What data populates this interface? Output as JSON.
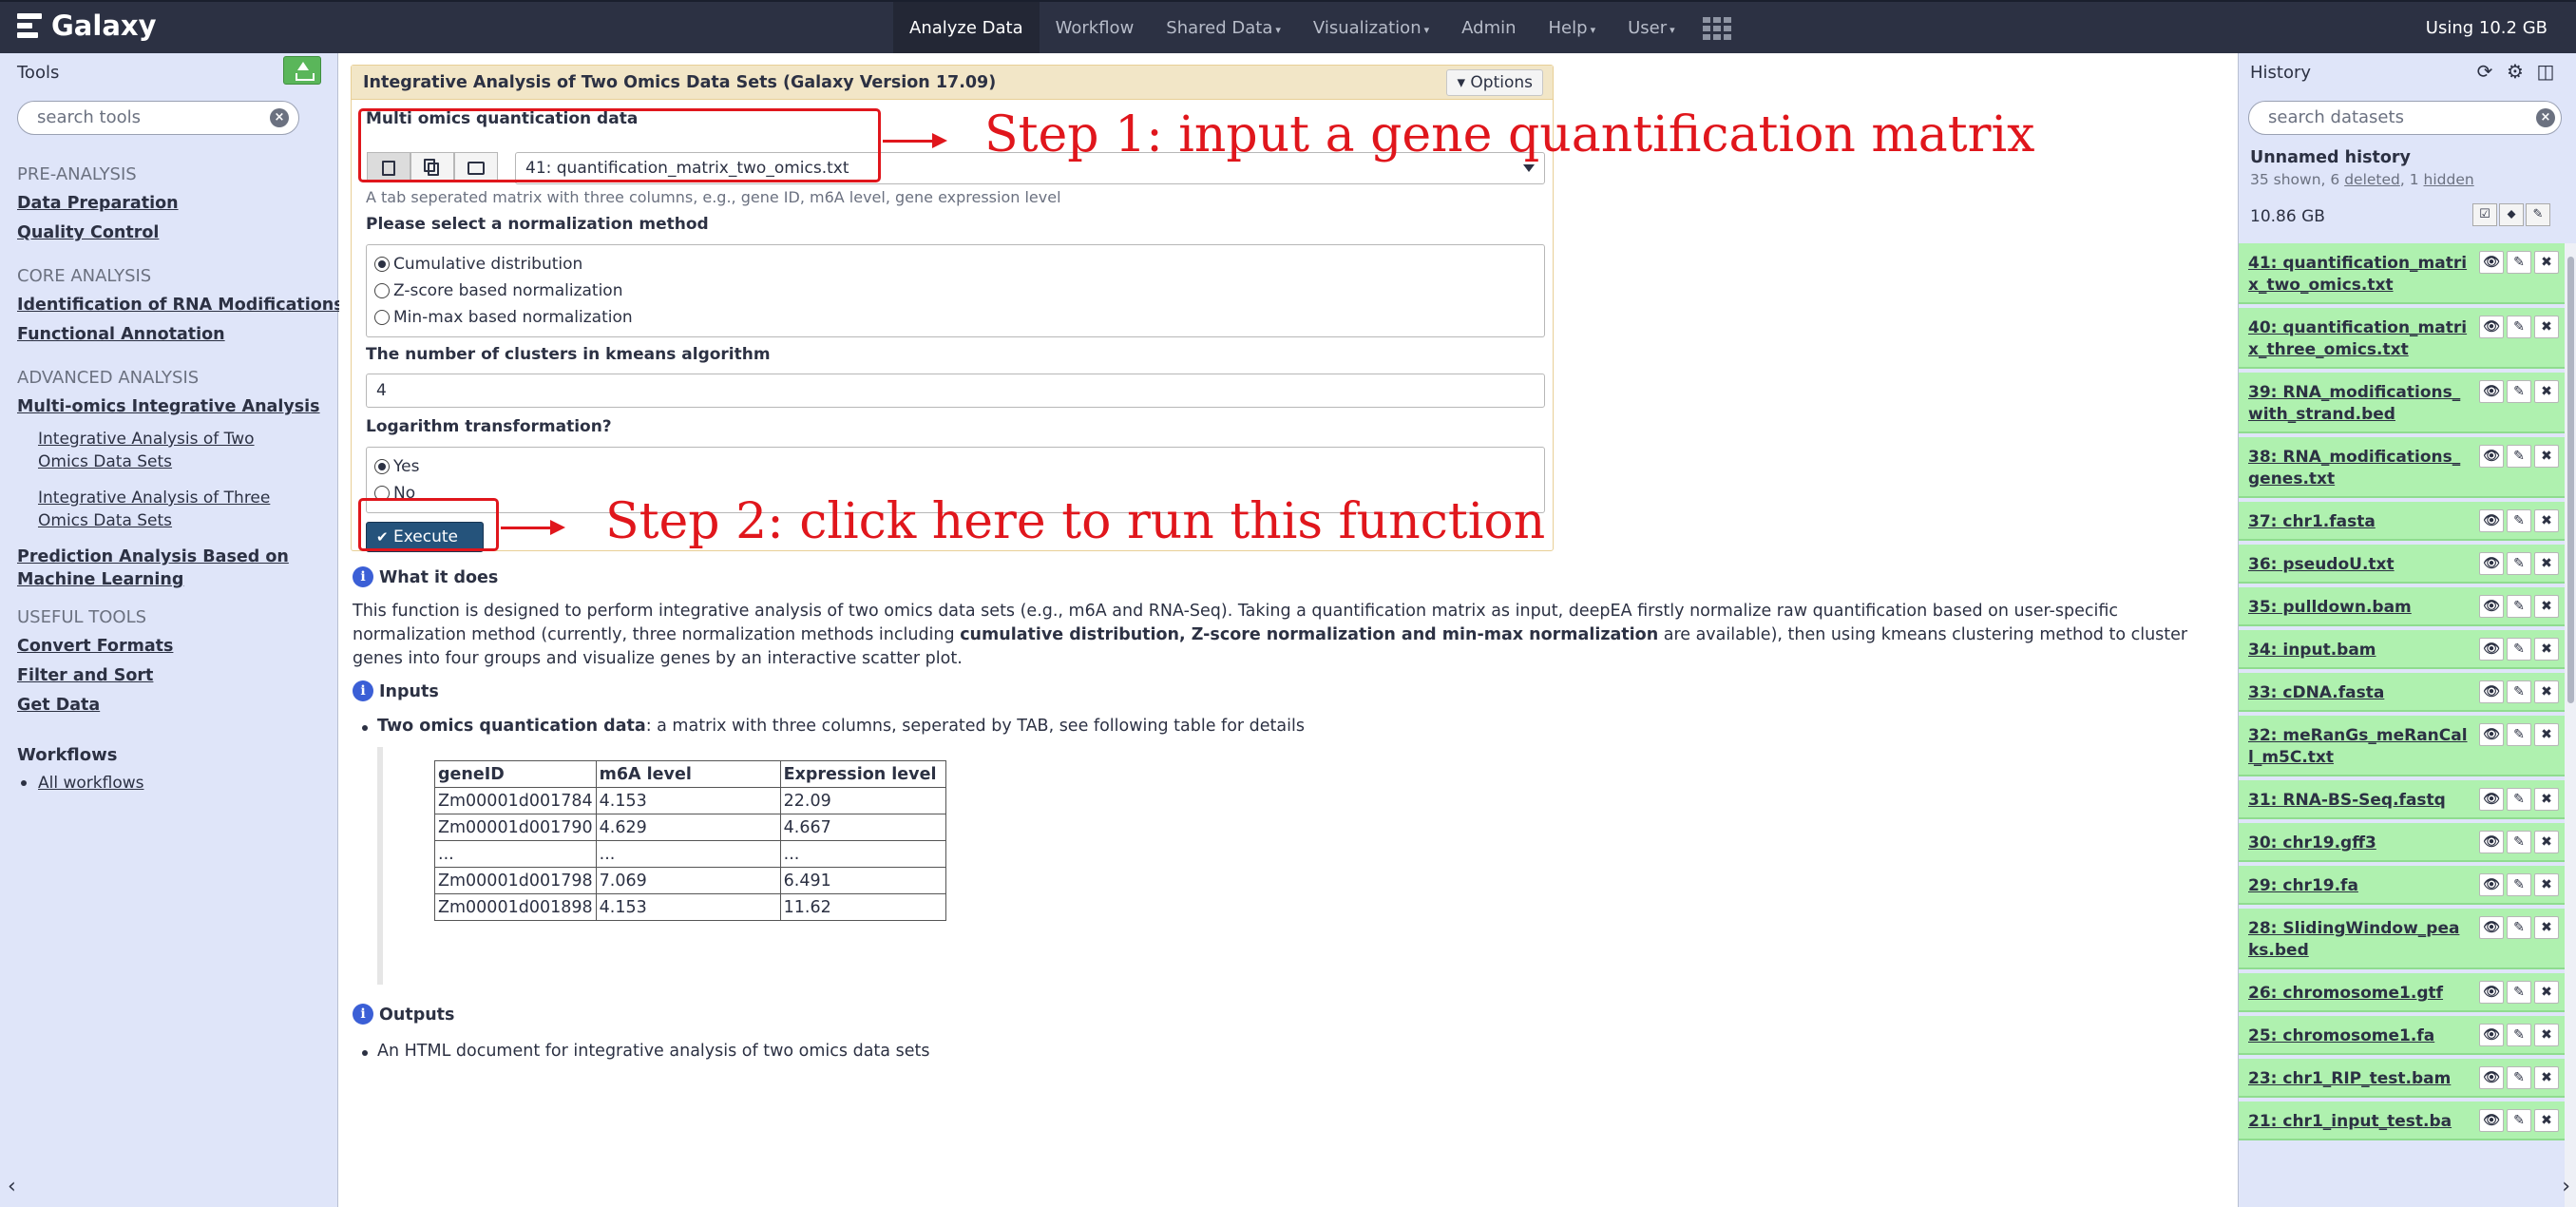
{
  "masthead": {
    "brand": "Galaxy",
    "nav": [
      {
        "label": "Analyze Data",
        "active": true,
        "caret": false
      },
      {
        "label": "Workflow",
        "active": false,
        "caret": false
      },
      {
        "label": "Shared Data",
        "active": false,
        "caret": true
      },
      {
        "label": "Visualization",
        "active": false,
        "caret": true
      },
      {
        "label": "Admin",
        "active": false,
        "caret": false
      },
      {
        "label": "Help",
        "active": false,
        "caret": true
      },
      {
        "label": "User",
        "active": false,
        "caret": true
      }
    ],
    "quota": "Using 10.2 GB"
  },
  "tools": {
    "title": "Tools",
    "search_placeholder": "search tools",
    "sections": {
      "pre": "PRE-ANALYSIS",
      "core": "CORE ANALYSIS",
      "advanced": "ADVANCED ANALYSIS",
      "useful": "USEFUL TOOLS"
    },
    "links": {
      "data_prep": "Data Preparation",
      "quality": "Quality Control",
      "rna_mod": "Identification of RNA Modifications",
      "func_annot": "Functional Annotation",
      "multi_omics": "Multi-omics Integrative Analysis",
      "two_omics": "Integrative Analysis of Two Omics Data Sets",
      "three_omics": "Integrative Analysis of Three Omics Data Sets",
      "prediction": "Prediction Analysis Based on Machine Learning",
      "convert": "Convert Formats",
      "filter": "Filter and Sort",
      "get_data": "Get Data"
    },
    "workflows_title": "Workflows",
    "workflows_item": "All workflows"
  },
  "form": {
    "title": "Integrative Analysis of Two Omics Data Sets (Galaxy Version 17.09)",
    "options_label": "Options",
    "input_label": "Multi omics quantication data",
    "input_value": "41: quantification_matrix_two_omics.txt",
    "input_help": "A tab seperated matrix with three columns, e.g., gene ID, m6A level, gene expression level",
    "norm_label": "Please select a normalization method",
    "norm_options": [
      "Cumulative distribution",
      "Z-score based normalization",
      "Min-max based normalization"
    ],
    "norm_selected": 0,
    "k_label": "The number of clusters in kmeans algorithm",
    "k_value": "4",
    "log_label": "Logarithm transformation?",
    "log_options": [
      "Yes",
      "No"
    ],
    "log_selected": 0,
    "execute_label": "Execute"
  },
  "annotations": {
    "step1": "Step 1: input a gene quantification matrix",
    "step2": "Step 2: click here to run this function",
    "color": "#e0161c"
  },
  "help": {
    "what_title": "What it does",
    "what_text_1": "This function is designed to perform integrative analysis of two omics data sets (e.g., m6A and RNA-Seq). Taking a quantification matrix as input, deepEA firstly normalize raw quantification based on user-specific normalization method (currently, three normalization methods including ",
    "what_text_bold": "cumulative distribution, Z-score normalization and min-max normalization",
    "what_text_2": " are available), then using kmeans clustering method to cluster genes into four groups and visualize genes by an interactive scatter plot.",
    "inputs_title": "Inputs",
    "inputs_bullet_bold": "Two omics quantication data",
    "inputs_bullet_rest": ": a matrix with three columns, seperated by TAB, see following table for details",
    "table_headers": [
      "geneID",
      "m6A level",
      "Expression level"
    ],
    "table_rows": [
      [
        "Zm00001d001784",
        "4.153",
        "22.09"
      ],
      [
        "Zm00001d001790",
        "4.629",
        "4.667"
      ],
      [
        "...",
        "...",
        "..."
      ],
      [
        "Zm00001d001798",
        "7.069",
        "6.491"
      ],
      [
        "Zm00001d001898",
        "4.153",
        "11.62"
      ]
    ],
    "outputs_title": "Outputs",
    "outputs_bullet": "An HTML document for integrative analysis of two omics data sets"
  },
  "history": {
    "title": "History",
    "search_placeholder": "search datasets",
    "name": "Unnamed history",
    "counts_prefix": "35 shown, 6 ",
    "deleted_link": "deleted",
    "counts_mid": ", 1 ",
    "hidden_link": "hidden",
    "size": "10.86 GB",
    "items": [
      "41: quantification_matrix_two_omics.txt",
      "40: quantification_matrix_three_omics.txt",
      "39: RNA_modifications_with_strand.bed",
      "38: RNA_modifications_genes.txt",
      "37: chr1.fasta",
      "36: pseudoU.txt",
      "35: pulldown.bam",
      "34: input.bam",
      "33: cDNA.fasta",
      "32: meRanGs_meRanCall_m5C.txt",
      "31: RNA-BS-Seq.fastq",
      "30: chr19.gff3",
      "29: chr19.fa",
      "28: SlidingWindow_peaks.bed",
      "26: chromosome1.gtf",
      "25: chromosome1.fa",
      "23: chr1_RIP_test.bam",
      "21: chr1_input_test.ba"
    ],
    "item_color": "#aff1af"
  }
}
